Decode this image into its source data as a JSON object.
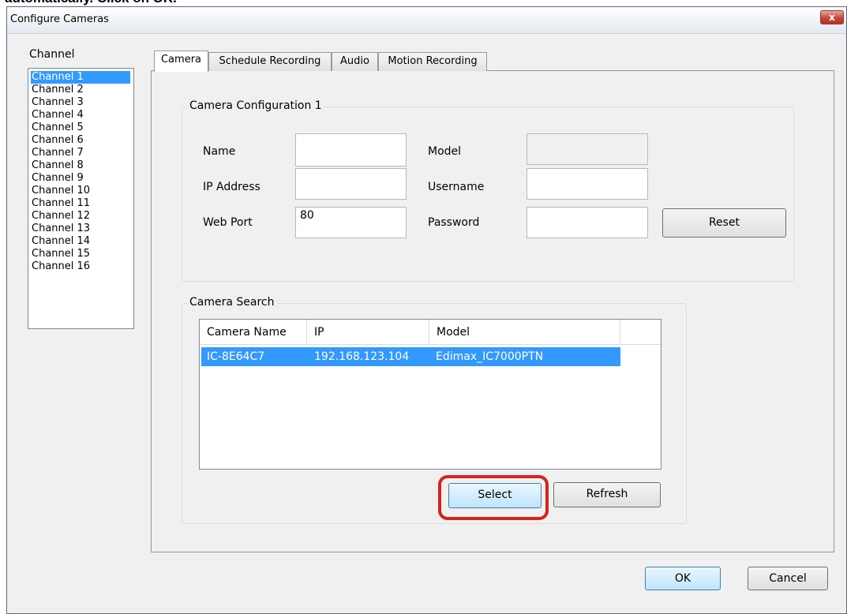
{
  "caption": "automatically.  Click on OK.",
  "window": {
    "title": "Configure Cameras",
    "close_symbol": "x"
  },
  "channel": {
    "label": "Channel",
    "items": [
      "Channel 1",
      "Channel 2",
      "Channel 3",
      "Channel 4",
      "Channel 5",
      "Channel 6",
      "Channel 7",
      "Channel 8",
      "Channel 9",
      "Channel 10",
      "Channel 11",
      "Channel 12",
      "Channel 13",
      "Channel 14",
      "Channel 15",
      "Channel 16"
    ],
    "selected": "Channel 1"
  },
  "tabs": [
    {
      "label": "Camera",
      "active": true
    },
    {
      "label": "Schedule Recording",
      "active": false
    },
    {
      "label": "Audio",
      "active": false
    },
    {
      "label": "Motion Recording",
      "active": false
    }
  ],
  "config": {
    "title": "Camera Configuration 1",
    "name_label": "Name",
    "name_value": "",
    "ip_label": "IP Address",
    "ip_value": "",
    "port_label": "Web Port",
    "port_value": "80",
    "model_label": "Model",
    "model_value": "",
    "username_label": "Username",
    "username_value": "",
    "password_label": "Password",
    "password_value": "",
    "reset_label": "Reset"
  },
  "search": {
    "title": "Camera Search",
    "columns": [
      "Camera Name",
      "IP",
      "Model"
    ],
    "rows": [
      {
        "name": "IC-8E64C7",
        "ip": "192.168.123.104",
        "model": "Edimax_IC7000PTN",
        "selected": true
      }
    ],
    "select_label": "Select",
    "refresh_label": "Refresh"
  },
  "footer": {
    "ok_label": "OK",
    "cancel_label": "Cancel"
  },
  "colors": {
    "selection": "#3399ff",
    "highlight_ring": "#d5231f",
    "close_button": "#c7473a"
  }
}
